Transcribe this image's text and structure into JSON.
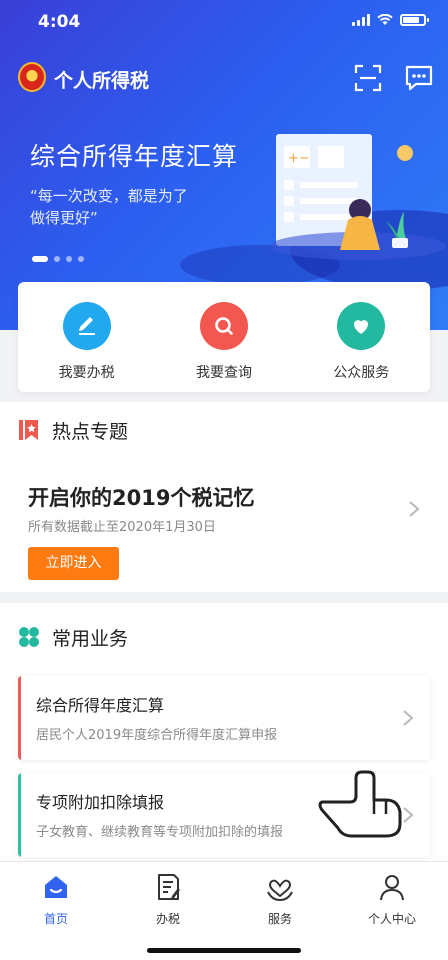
{
  "status": {
    "time": "4:04"
  },
  "header": {
    "title": "个人所得税"
  },
  "banner": {
    "title": "综合所得年度汇算",
    "subtitle": "“每一次改变，都是为了做得更好”",
    "slide_count": 4,
    "active_slide": 1
  },
  "quick_actions": [
    {
      "label": "我要办税",
      "icon": "edit-icon",
      "color": "#22a8ef"
    },
    {
      "label": "我要查询",
      "icon": "search-icon",
      "color": "#f2584f"
    },
    {
      "label": "公众服务",
      "icon": "heart-icon",
      "color": "#23b9a0"
    }
  ],
  "hot_topics": {
    "section_title": "热点专题",
    "headline": "开启你的2019个税记忆",
    "note": "所有数据截止至2020年1月30日",
    "button_label": "立即进入"
  },
  "common_business": {
    "section_title": "常用业务",
    "items": [
      {
        "title": "综合所得年度汇算",
        "desc": "居民个人2019年度综合所得年度汇算申报",
        "accent": "#ee5a5a"
      },
      {
        "title": "专项附加扣除填报",
        "desc": "子女教育、继续教育等专项附加扣除的填报",
        "accent": "#2fc3a6"
      }
    ]
  },
  "tabs": [
    {
      "label": "首页",
      "active": true
    },
    {
      "label": "办税",
      "active": false
    },
    {
      "label": "服务",
      "active": false
    },
    {
      "label": "个人中心",
      "active": false
    }
  ],
  "colors": {
    "brand": "#2f63f0",
    "orange": "#ff7a11"
  }
}
